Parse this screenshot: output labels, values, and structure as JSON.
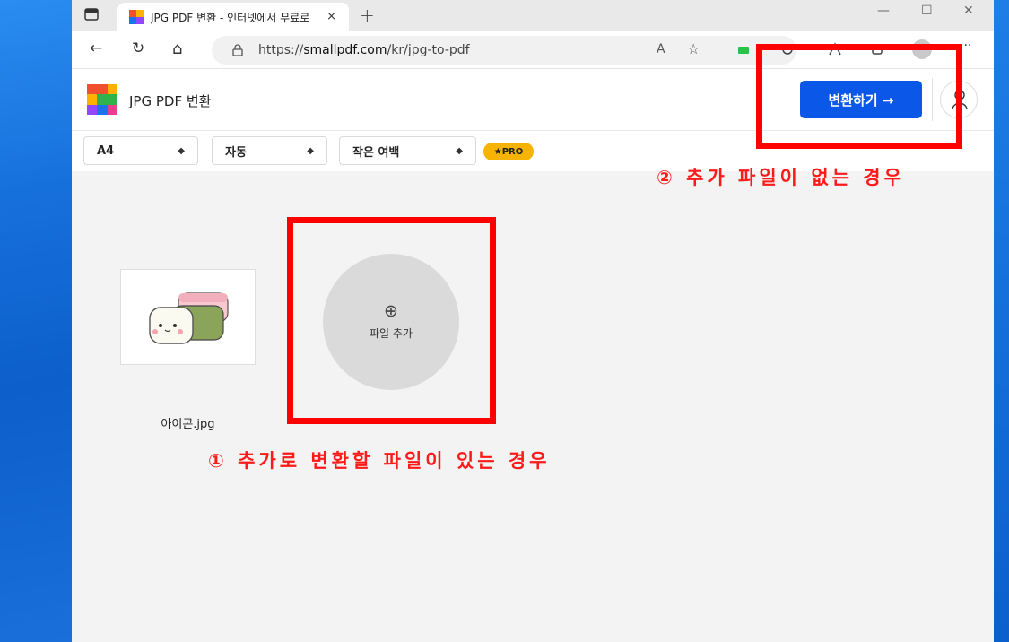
{
  "browser": {
    "tab_title": "JPG PDF 변환 - 인터넷에서 무료로",
    "tab_close": "×",
    "new_tab": "+",
    "url_prefix": "https://",
    "url_host": "smallpdf.com",
    "url_path": "/kr/jpg-to-pdf",
    "window_controls": {
      "minimize": "—",
      "maximize": "☐",
      "close": "✕"
    },
    "nav": {
      "back": "←",
      "reload": "↻",
      "home": "⌂",
      "read_aloud": "A",
      "favorite": "☆",
      "more": "···"
    }
  },
  "app": {
    "title": "JPG PDF 변환",
    "convert_button": "변환하기 →",
    "brand_colors": [
      "#f0502e",
      "#ffb100",
      "#2fb34a",
      "#1a73e8",
      "#9146ff",
      "#e83e8c"
    ]
  },
  "options": {
    "page_size": "A4",
    "orientation": "자동",
    "margin": "작은 여백",
    "pro_label": "★PRO"
  },
  "workspace": {
    "file_name": "아이콘.jpg",
    "add_plus": "⊕",
    "add_label": "파일 추가"
  },
  "annotations": {
    "case_one": "① 추가로 변환할 파일이 있는 경우",
    "case_two": "② 추가 파일이 없는 경우",
    "color": "#ff0000"
  }
}
